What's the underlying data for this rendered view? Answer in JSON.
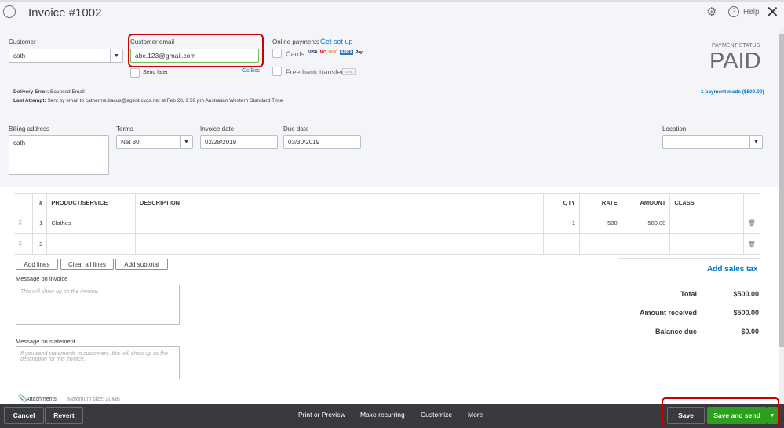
{
  "header": {
    "title": "Invoice #1002",
    "help": "Help"
  },
  "customer": {
    "label": "Customer",
    "value": "cath"
  },
  "email": {
    "label": "Customer email",
    "value": "abc.123@gmail.com",
    "send_later": "Send later",
    "cc_bcc": "Cc/Bcc"
  },
  "online": {
    "label": "Online payments",
    "setup": "Get set up",
    "cards": "Cards",
    "bank": "Free bank transfer",
    "bank_badge": "BANK",
    "card_brands": [
      "VISA",
      "MC",
      "DISC",
      "AMEX",
      "Pay"
    ]
  },
  "status": {
    "label": "PAYMENT STATUS",
    "value": "PAID",
    "payment_link": "1 payment made ($500.00)"
  },
  "delivery": {
    "error_label": "Delivery Error:",
    "error": "Bounced Email",
    "attempt_label": "Last Attempt:",
    "attempt": "Sent by email to catherine.bacus@agent.cvgs.net at Feb 28, 9:59 pm Australian Western Standard Time"
  },
  "billing": {
    "label": "Billing address",
    "value": "cath"
  },
  "terms": {
    "label": "Terms",
    "value": "Net 30"
  },
  "invoice_date": {
    "label": "Invoice date",
    "value": "02/28/2019"
  },
  "due_date": {
    "label": "Due date",
    "value": "03/30/2019"
  },
  "location": {
    "label": "Location",
    "value": ""
  },
  "table": {
    "headers": [
      "#",
      "PRODUCT/SERVICE",
      "DESCRIPTION",
      "QTY",
      "RATE",
      "AMOUNT",
      "CLASS"
    ],
    "rows": [
      {
        "n": "1",
        "product": "Clothes",
        "desc": "",
        "qty": "1",
        "rate": "500",
        "amount": "500.00",
        "class": ""
      },
      {
        "n": "2",
        "product": "",
        "desc": "",
        "qty": "",
        "rate": "",
        "amount": "",
        "class": ""
      }
    ]
  },
  "actions": {
    "add_lines": "Add lines",
    "clear": "Clear all lines",
    "subtotal": "Add subtotal",
    "sales_tax": "Add sales tax"
  },
  "message_invoice": {
    "label": "Message on invoice",
    "placeholder": "This will show up on the invoice."
  },
  "message_statement": {
    "label": "Message on statement",
    "placeholder": "If you send statements to customers, this will show up as the description for this invoice."
  },
  "attachments": {
    "label": "Attachments",
    "max": "Maximum size: 20MB"
  },
  "totals": {
    "total_label": "Total",
    "total": "$500.00",
    "received_label": "Amount received",
    "received": "$500.00",
    "balance_label": "Balance due",
    "balance": "$0.00"
  },
  "footer": {
    "cancel": "Cancel",
    "revert": "Revert",
    "print": "Print or Preview",
    "recurring": "Make recurring",
    "customize": "Customize",
    "more": "More",
    "save": "Save",
    "save_send": "Save and send"
  }
}
